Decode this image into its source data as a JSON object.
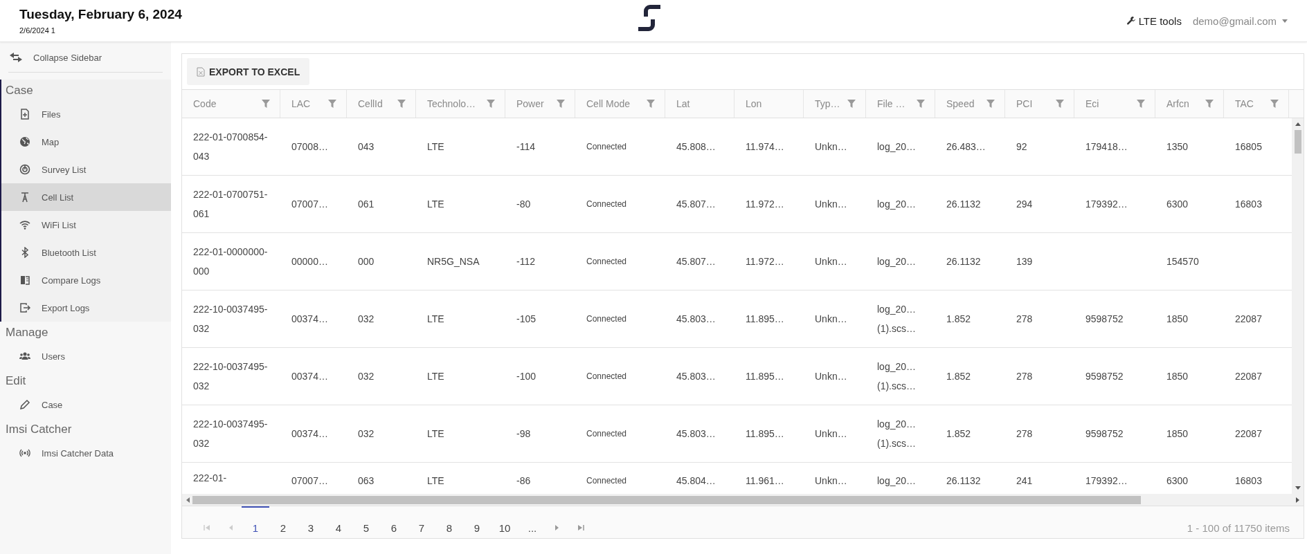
{
  "header": {
    "title": "Tuesday, February 6, 2024",
    "subtitle": "2/6/2024 1",
    "tools_link": "LTE tools",
    "user": "demo@gmail.com"
  },
  "sidebar": {
    "collapse": "Collapse Sidebar",
    "sections": [
      {
        "title": "Case",
        "items": [
          {
            "label": "Files",
            "selected": false
          },
          {
            "label": "Map",
            "selected": false
          },
          {
            "label": "Survey List",
            "selected": false
          },
          {
            "label": "Cell List",
            "selected": true
          },
          {
            "label": "WiFi List",
            "selected": false
          },
          {
            "label": "Bluetooth List",
            "selected": false
          },
          {
            "label": "Compare Logs",
            "selected": false
          },
          {
            "label": "Export Logs",
            "selected": false
          }
        ]
      },
      {
        "title": "Manage",
        "items": [
          {
            "label": "Users",
            "selected": false
          }
        ]
      },
      {
        "title": "Edit",
        "items": [
          {
            "label": "Case",
            "selected": false
          }
        ]
      },
      {
        "title": "Imsi Catcher",
        "items": [
          {
            "label": "Imsi Catcher Data",
            "selected": false
          }
        ]
      }
    ]
  },
  "toolbar": {
    "export_button": "EXPORT TO EXCEL"
  },
  "table": {
    "columns": [
      {
        "label": "Code",
        "filterable": true,
        "kind": "text"
      },
      {
        "label": "LAC",
        "filterable": true,
        "kind": "text"
      },
      {
        "label": "CellId",
        "filterable": true,
        "kind": "text"
      },
      {
        "label": "Technolo…",
        "filterable": true,
        "kind": "text"
      },
      {
        "label": "Power",
        "filterable": true,
        "kind": "text"
      },
      {
        "label": "Cell Mode",
        "filterable": true,
        "kind": "status"
      },
      {
        "label": "Lat",
        "filterable": false,
        "kind": "text"
      },
      {
        "label": "Lon",
        "filterable": false,
        "kind": "text"
      },
      {
        "label": "Typ…",
        "filterable": true,
        "kind": "text"
      },
      {
        "label": "File …",
        "filterable": true,
        "kind": "text"
      },
      {
        "label": "Speed",
        "filterable": true,
        "kind": "text"
      },
      {
        "label": "PCI",
        "filterable": true,
        "kind": "text"
      },
      {
        "label": "Eci",
        "filterable": true,
        "kind": "text"
      },
      {
        "label": "Arfcn",
        "filterable": true,
        "kind": "text"
      },
      {
        "label": "TAC",
        "filterable": true,
        "kind": "text"
      }
    ],
    "rows": [
      [
        "222-01-0700854-043",
        "07008…",
        "043",
        "LTE",
        "-114",
        "Connected",
        "45.808…",
        "11.974…",
        "Unkn…",
        "log_20…",
        "26.483…",
        "92",
        "179418…",
        "1350",
        "16805"
      ],
      [
        "222-01-0700751-061",
        "07007…",
        "061",
        "LTE",
        "-80",
        "Connected",
        "45.807…",
        "11.972…",
        "Unkn…",
        "log_20…",
        "26.1132",
        "294",
        "179392…",
        "6300",
        "16803"
      ],
      [
        "222-01-0000000-000",
        "00000…",
        "000",
        "NR5G_NSA",
        "-112",
        "Connected",
        "45.807…",
        "11.972…",
        "Unkn…",
        "log_20…",
        "26.1132",
        "139",
        null,
        "154570",
        null
      ],
      [
        "222-10-0037495-032",
        "00374…",
        "032",
        "LTE",
        "-105",
        "Connected",
        "45.803…",
        "11.895…",
        "Unkn…",
        "log_20… (1).scs…",
        "1.852",
        "278",
        "9598752",
        "1850",
        "22087"
      ],
      [
        "222-10-0037495-032",
        "00374…",
        "032",
        "LTE",
        "-100",
        "Connected",
        "45.803…",
        "11.895…",
        "Unkn…",
        "log_20… (1).scs…",
        "1.852",
        "278",
        "9598752",
        "1850",
        "22087"
      ],
      [
        "222-10-0037495-032",
        "00374…",
        "032",
        "LTE",
        "-98",
        "Connected",
        "45.803…",
        "11.895…",
        "Unkn…",
        "log_20… (1).scs…",
        "1.852",
        "278",
        "9598752",
        "1850",
        "22087"
      ],
      [
        "222-01-",
        "07007…",
        "063",
        "LTE",
        "-86",
        "Connected",
        "45.804…",
        "11.961…",
        "Unkn…",
        "log_20…",
        "26.1132",
        "241",
        "179392…",
        "6300",
        "16803"
      ]
    ]
  },
  "pager": {
    "pages": [
      {
        "label": "1",
        "selected": true
      },
      {
        "label": "2",
        "selected": false
      },
      {
        "label": "3",
        "selected": false
      },
      {
        "label": "4",
        "selected": false
      },
      {
        "label": "5",
        "selected": false
      },
      {
        "label": "6",
        "selected": false
      },
      {
        "label": "7",
        "selected": false
      },
      {
        "label": "8",
        "selected": false
      },
      {
        "label": "9",
        "selected": false
      },
      {
        "label": "10",
        "selected": false
      }
    ],
    "more": "...",
    "info": "1 - 100 of 11750 items"
  }
}
